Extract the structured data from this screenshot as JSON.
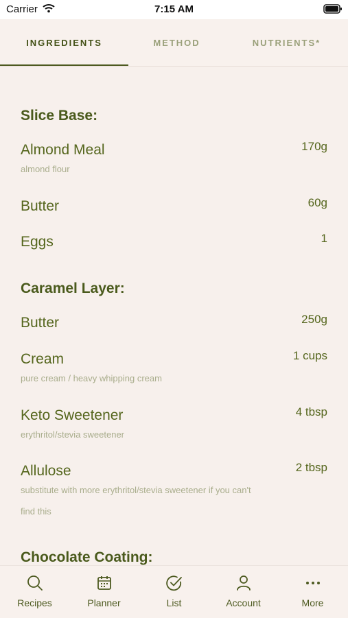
{
  "status": {
    "carrier": "Carrier",
    "time": "7:15 AM"
  },
  "tabs": [
    {
      "label": "INGREDIENTS"
    },
    {
      "label": "METHOD"
    },
    {
      "label": "NUTRIENTS*"
    }
  ],
  "sections": [
    {
      "title": "Slice Base:",
      "items": [
        {
          "name": "Almond Meal",
          "qty": "170g",
          "note": "almond flour"
        },
        {
          "name": "Butter",
          "qty": "60g"
        },
        {
          "name": "Eggs",
          "qty": "1"
        }
      ]
    },
    {
      "title": "Caramel Layer:",
      "items": [
        {
          "name": "Butter",
          "qty": "250g"
        },
        {
          "name": "Cream",
          "qty": "1 cups",
          "note": "pure cream / heavy whipping cream"
        },
        {
          "name": "Keto Sweetener",
          "qty": "4 tbsp",
          "note": "erythritol/stevia sweetener"
        },
        {
          "name": "Allulose",
          "qty": "2 tbsp",
          "note": "substitute with more erythritol/stevia sweetener if you can't find this"
        }
      ]
    },
    {
      "title": "Chocolate Coating:"
    }
  ],
  "nav": [
    {
      "label": "Recipes",
      "icon": "search-icon"
    },
    {
      "label": "Planner",
      "icon": "calendar-icon"
    },
    {
      "label": "List",
      "icon": "checkmark-circle-icon"
    },
    {
      "label": "Account",
      "icon": "person-icon"
    },
    {
      "label": "More",
      "icon": "ellipsis-icon"
    }
  ]
}
